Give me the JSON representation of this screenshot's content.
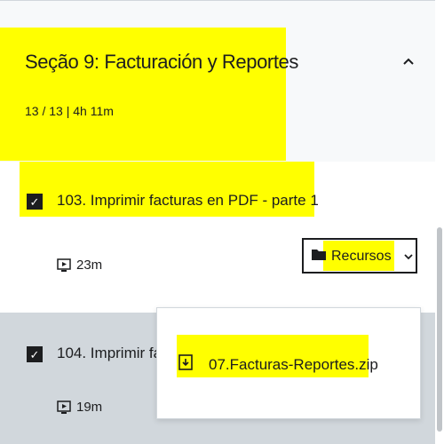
{
  "section": {
    "title": "Seção 9: Facturación y Reportes",
    "meta": "13 / 13 | 4h 11m",
    "collapse_icon": "chevron-up-icon"
  },
  "lectures": [
    {
      "title": "103. Imprimir facturas en PDF - parte 1",
      "duration": "23m",
      "checked": true,
      "resources_label": "Recursos"
    },
    {
      "title": "104. Imprimir fa",
      "duration": "19m",
      "checked": true
    }
  ],
  "resources_dropdown": {
    "items": [
      {
        "label": "07.Facturas-Reportes.zip",
        "icon": "file-download-icon"
      }
    ]
  },
  "colors": {
    "highlight": "#ffff00",
    "background": "#f7f9fa",
    "selected_row": "#d1d7dc",
    "text": "#1c1d1f"
  }
}
